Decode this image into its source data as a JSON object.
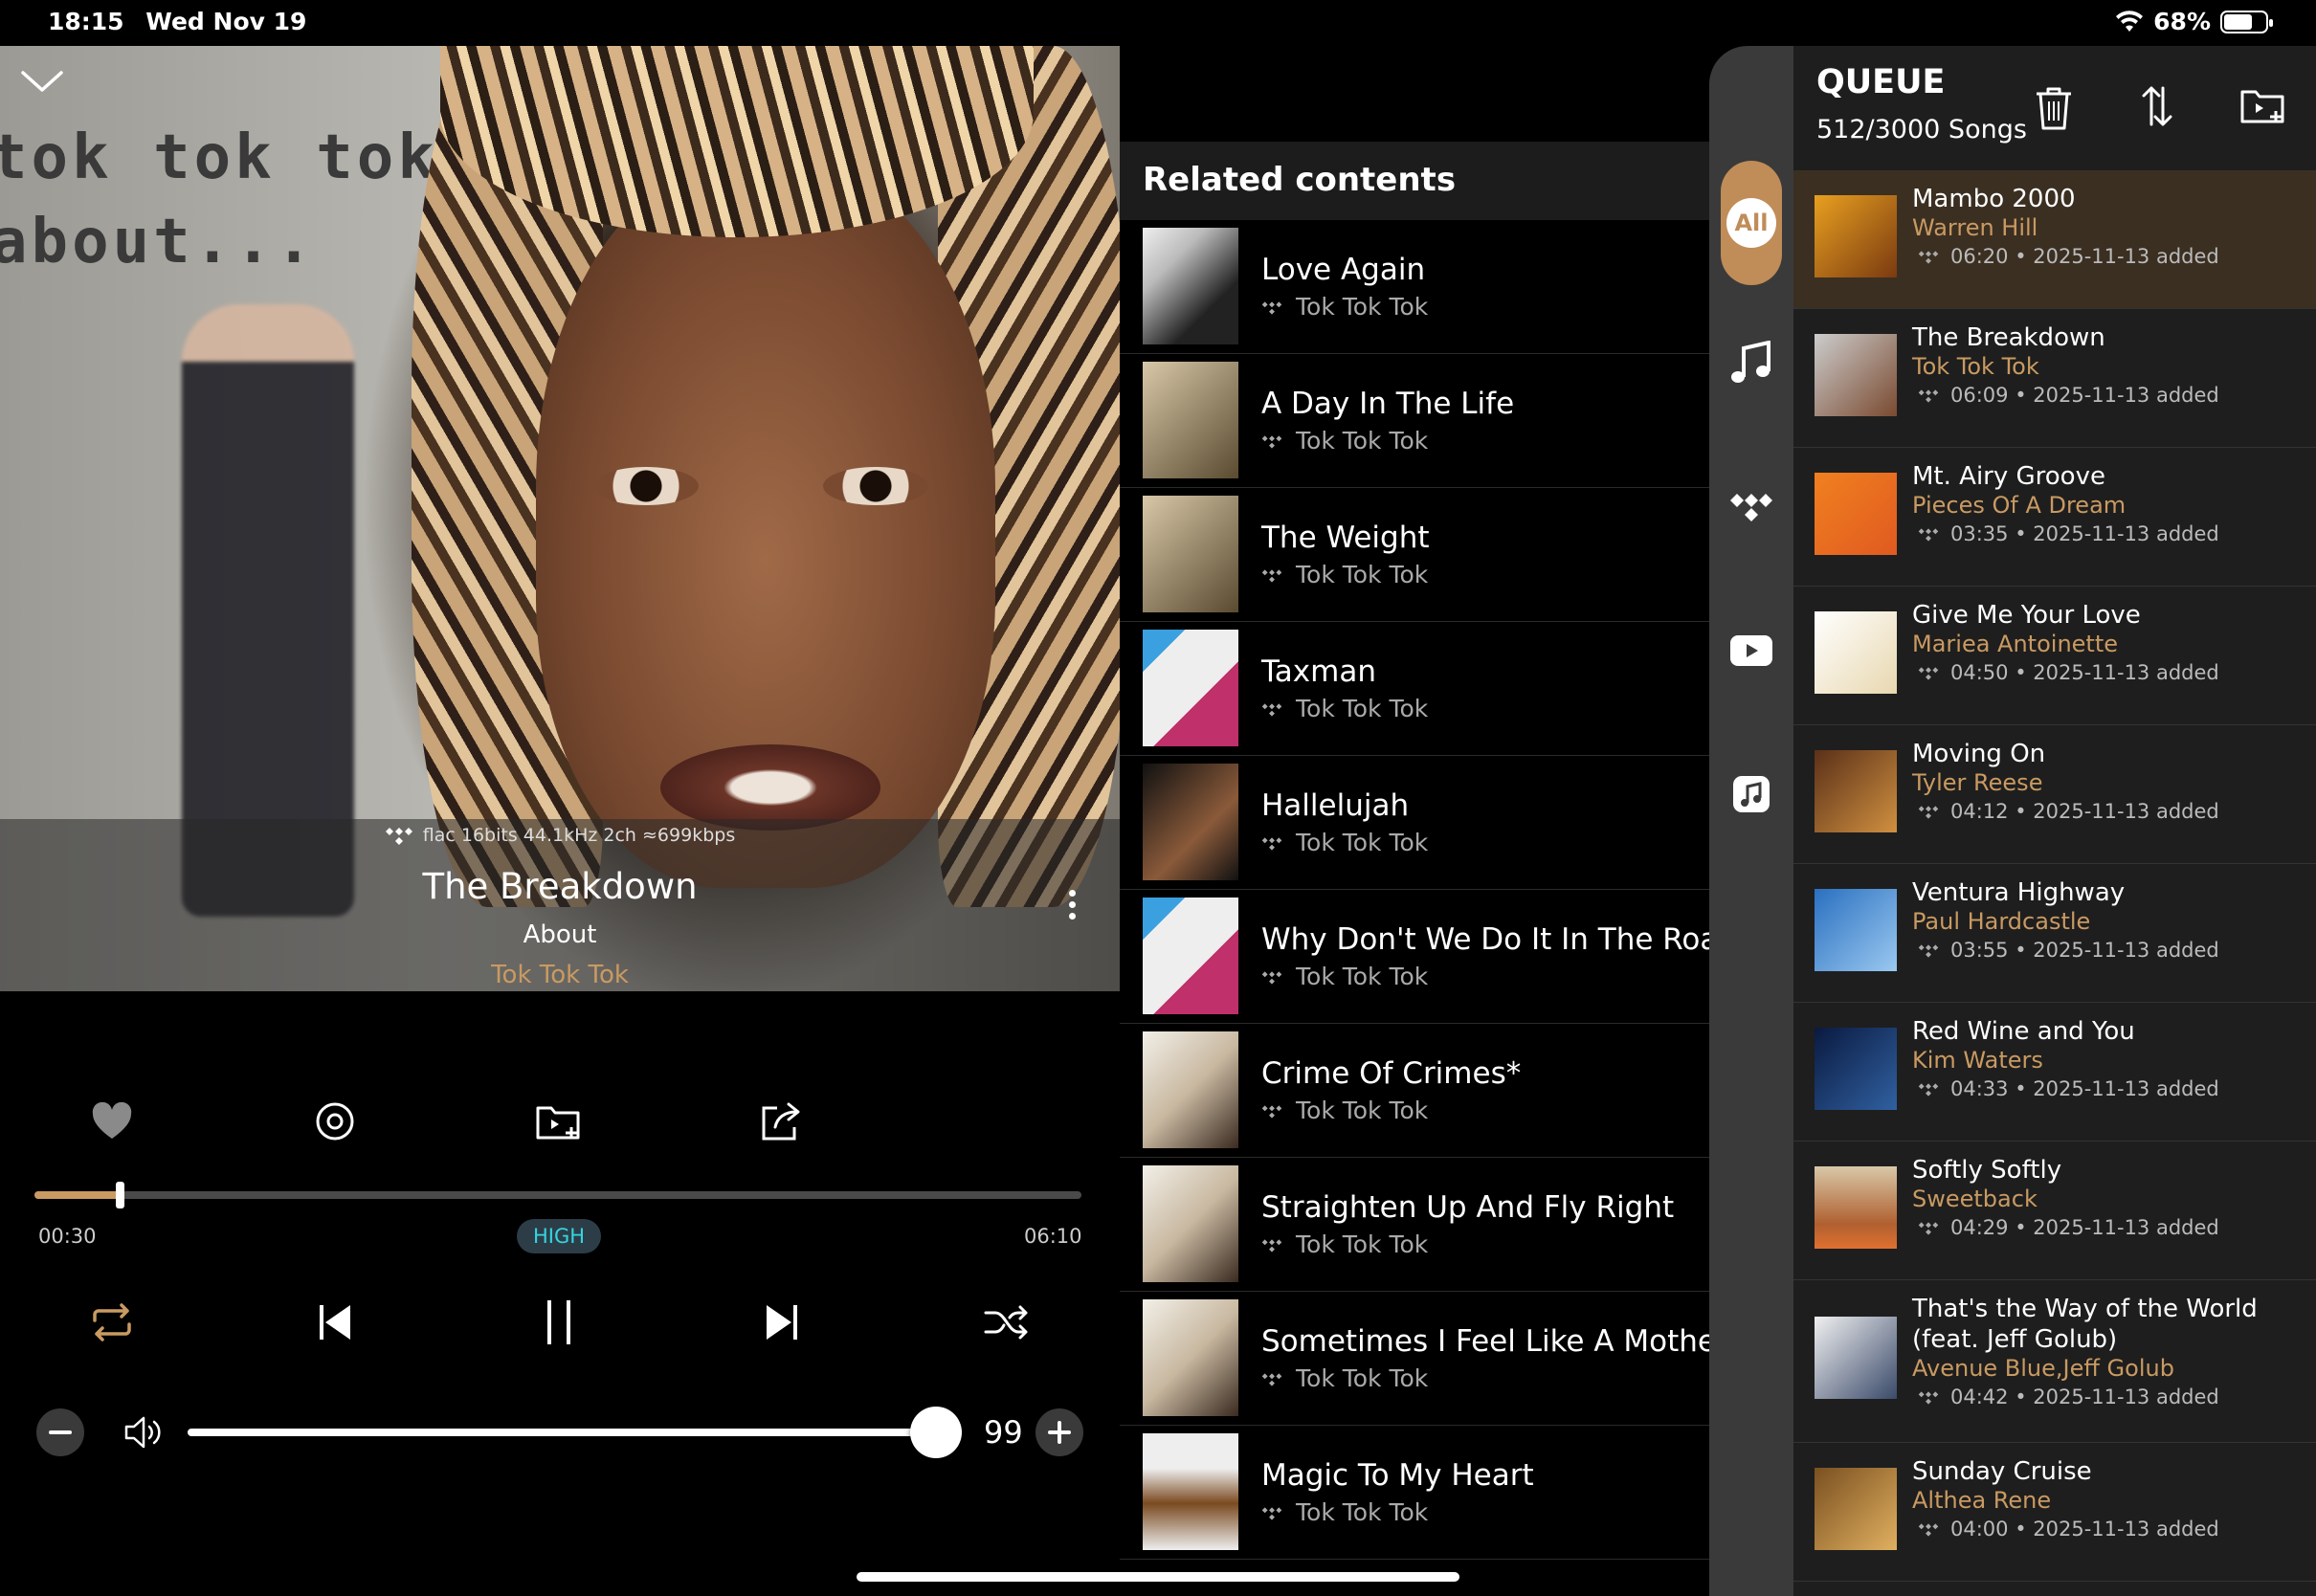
{
  "status_bar": {
    "time": "18:15",
    "date": "Wed Nov 19",
    "battery": "68%",
    "battery_level": 0.68
  },
  "artwork": {
    "text_line1": "tok tok tok",
    "text_line2": "about..."
  },
  "now_playing": {
    "format": "flac 16bits 44.1kHz 2ch ≈699kbps",
    "title": "The Breakdown",
    "album": "About",
    "artist": "Tok Tok Tok",
    "elapsed": "00:30",
    "total": "06:10",
    "progress": 0.081,
    "quality": "HIGH",
    "volume": "99",
    "volume_level": 0.99
  },
  "icons": {
    "collapse": "chevron-down-icon",
    "like": "heart-icon",
    "target": "target-icon",
    "add_to_playlist": "add-to-playlist-icon",
    "share": "share-icon",
    "repeat": "repeat-icon",
    "prev": "skip-previous-icon",
    "pause": "pause-icon",
    "next": "skip-next-icon",
    "shuffle": "shuffle-icon",
    "vol_down": "minus-icon",
    "speaker": "speaker-icon",
    "vol_up": "plus-icon"
  },
  "colors": {
    "accent": "#c99a62",
    "quality_text": "#33d6e0",
    "rail_active": "#c08c58"
  },
  "related": {
    "header": "Related contents",
    "items": [
      {
        "title": "Love Again",
        "artist": "Tok Tok Tok"
      },
      {
        "title": "A Day In The Life",
        "artist": "Tok Tok Tok"
      },
      {
        "title": "The Weight",
        "artist": "Tok Tok Tok"
      },
      {
        "title": "Taxman",
        "artist": "Tok Tok Tok"
      },
      {
        "title": "Hallelujah",
        "artist": "Tok Tok Tok"
      },
      {
        "title": "Why Don't We Do It In The Road",
        "artist": "Tok Tok Tok"
      },
      {
        "title": "Crime Of Crimes*",
        "artist": "Tok Tok Tok"
      },
      {
        "title": "Straighten Up And Fly Right",
        "artist": "Tok Tok Tok"
      },
      {
        "title": "Sometimes I Feel Like A Motherle",
        "artist": "Tok Tok Tok"
      },
      {
        "title": "Magic To My Heart",
        "artist": "Tok Tok Tok"
      }
    ]
  },
  "rail": {
    "all_label": "All"
  },
  "queue": {
    "title": "QUEUE",
    "count": "512/3000 Songs",
    "items": [
      {
        "title": "Mambo 2000",
        "artist": "Warren Hill",
        "meta": "06:20  •  2025-11-13 added",
        "active": true
      },
      {
        "title": "The Breakdown",
        "artist": "Tok Tok Tok",
        "meta": "06:09  •  2025-11-13 added"
      },
      {
        "title": "Mt. Airy Groove",
        "artist": "Pieces Of A Dream",
        "meta": "03:35  •  2025-11-13 added"
      },
      {
        "title": "Give Me Your Love",
        "artist": "Mariea Antoinette",
        "meta": "04:50  •  2025-11-13 added"
      },
      {
        "title": "Moving On",
        "artist": "Tyler Reese",
        "meta": "04:12  •  2025-11-13 added"
      },
      {
        "title": "Ventura Highway",
        "artist": "Paul Hardcastle",
        "meta": "03:55  •  2025-11-13 added"
      },
      {
        "title": "Red Wine and You",
        "artist": "Kim Waters",
        "meta": "04:33  •  2025-11-13 added"
      },
      {
        "title": "Softly Softly",
        "artist": "Sweetback",
        "meta": "04:29  •  2025-11-13 added"
      },
      {
        "title": "That's the Way of the World (feat. Jeff Golub)",
        "artist": "Avenue Blue,Jeff Golub",
        "meta": "04:42  •  2025-11-13 added"
      },
      {
        "title": "Sunday Cruise",
        "artist": "Althea Rene",
        "meta": "04:00  •  2025-11-13 added"
      }
    ]
  }
}
